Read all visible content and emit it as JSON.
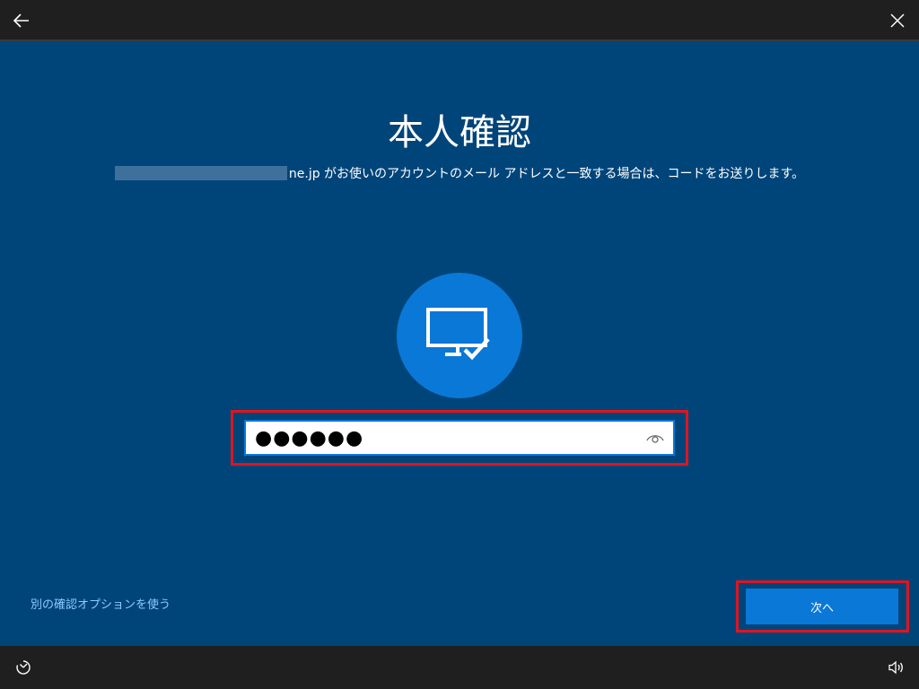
{
  "header": {
    "back_icon": "arrow-left-icon",
    "close_icon": "close-icon"
  },
  "main": {
    "title": "本人確認",
    "subtitle": "ne.jp がお使いのアカウントのメール アドレスと一致する場合は、コードをお送りします。",
    "device_icon": "monitor-check-icon",
    "code_input": {
      "value": "●●●●●●",
      "reveal_icon": "eye-icon"
    },
    "alt_option_link": "別の確認オプションを使う",
    "next_button": "次へ"
  },
  "footer": {
    "ease_of_access_icon": "ease-of-access-icon",
    "volume_icon": "volume-icon"
  },
  "colors": {
    "background": "#00457a",
    "accent": "#0a78d6",
    "link": "#8cc9ff",
    "highlight": "#e0141e",
    "bar": "#1f1f1f"
  }
}
